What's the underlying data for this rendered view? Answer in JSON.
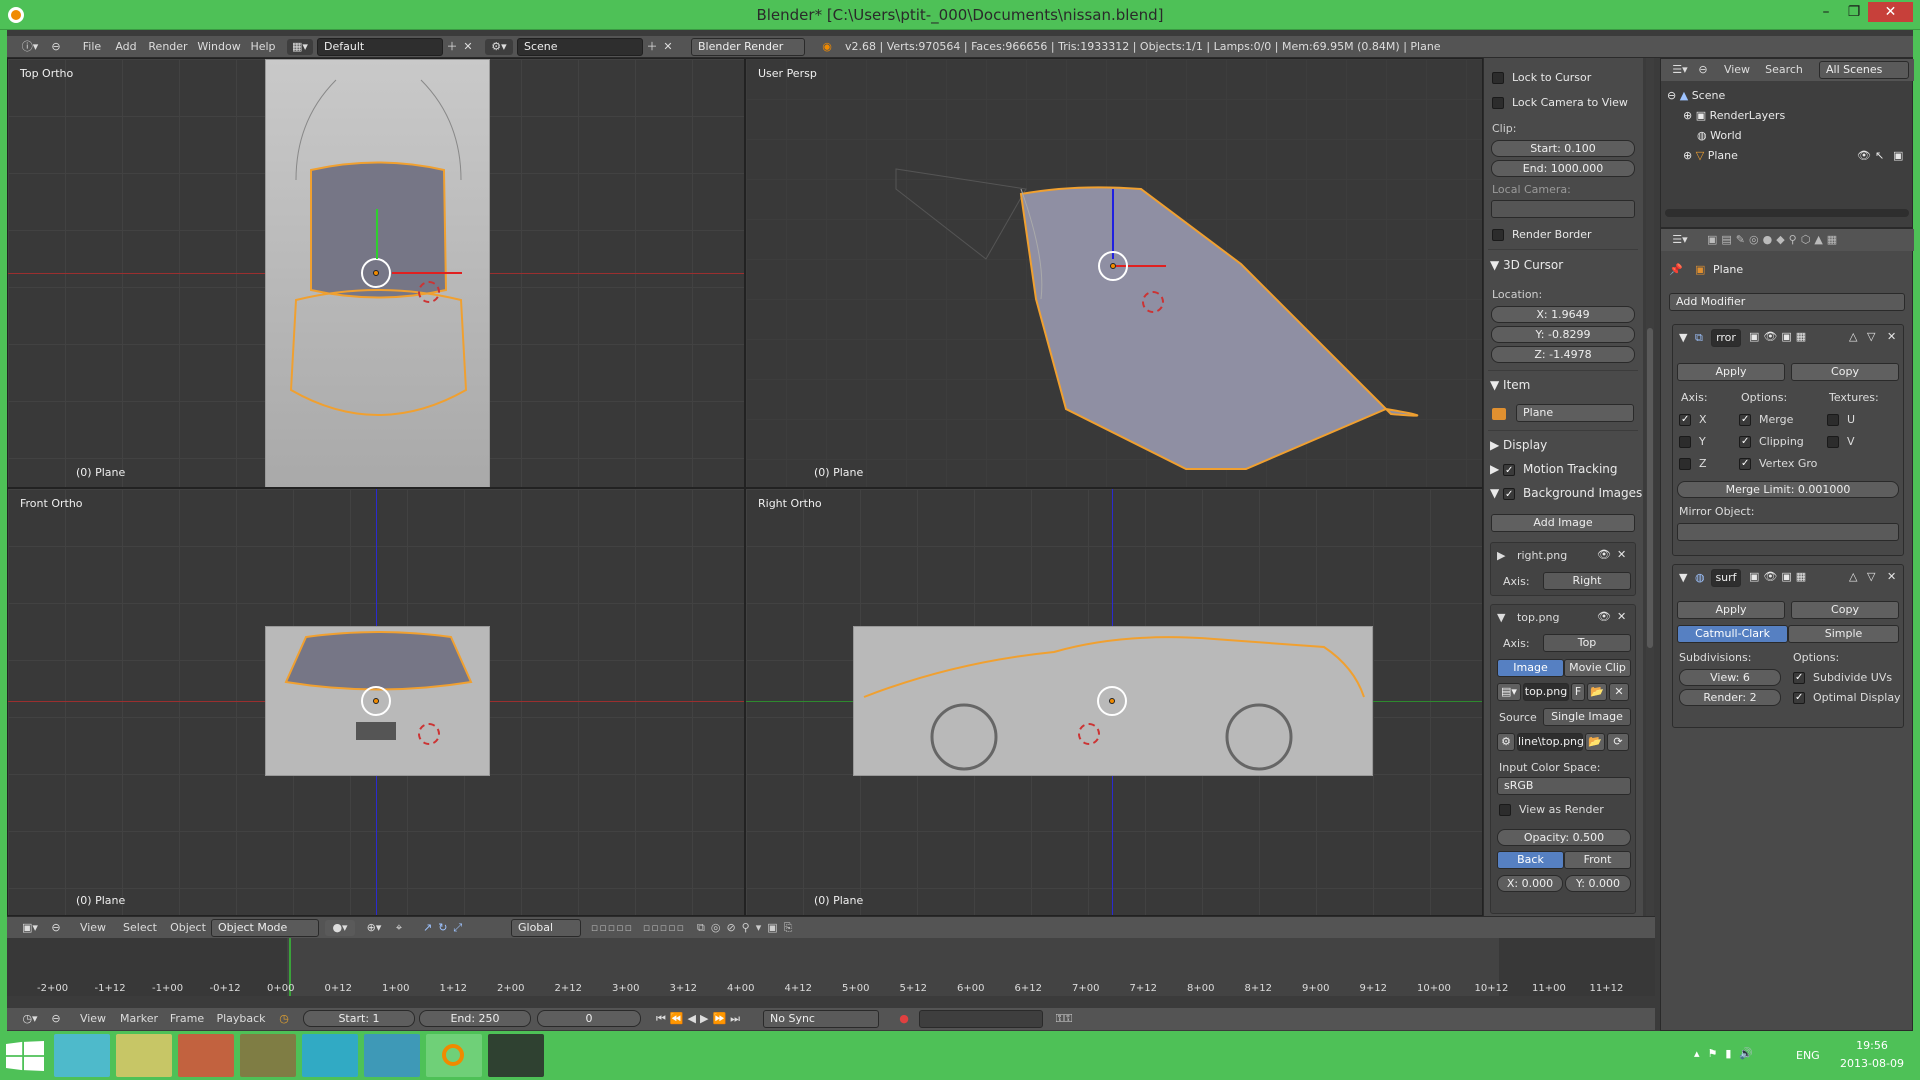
{
  "title": "Blender* [C:\\Users\\ptit-_000\\Documents\\nissan.blend]",
  "window_controls": {
    "minimize": "–",
    "maximize": "❐",
    "close": "✕"
  },
  "infobar": {
    "menus": [
      "File",
      "Add",
      "Render",
      "Window",
      "Help"
    ],
    "layout": "Default",
    "scene": "Scene",
    "engine": "Blender Render",
    "stats": "v2.68 | Verts:970564 | Faces:966656 | Tris:1933312 | Objects:1/1 | Lamps:0/0 | Mem:69.95M (0.84M) | Plane"
  },
  "viewports": {
    "top": {
      "label": "Top Ortho",
      "object": "(0) Plane"
    },
    "persp": {
      "label": "User Persp",
      "object": "(0) Plane"
    },
    "front": {
      "label": "Front Ortho",
      "object": "(0) Plane"
    },
    "right": {
      "label": "Right Ortho",
      "object": "(0) Plane"
    }
  },
  "npanel": {
    "lock_to_cursor": "Lock to Cursor",
    "lock_camera": "Lock Camera to View",
    "clip": "Clip:",
    "clip_start": "Start: 0.100",
    "clip_end": "End: 1000.000",
    "local_camera": "Local Camera:",
    "render_border": "Render Border",
    "cursor_header": "3D Cursor",
    "location": "Location:",
    "loc_x": "X: 1.9649",
    "loc_y": "Y: -0.8299",
    "loc_z": "Z: -1.4978",
    "item_header": "Item",
    "item_name": "Plane",
    "display": "Display",
    "motion_tracking": "Motion Tracking",
    "bg_images": "Background Images",
    "add_image": "Add Image",
    "bg1_name": "right.png",
    "axis_label": "Axis:",
    "bg1_axis": "Right",
    "bg2_name": "top.png",
    "bg2_axis": "Top",
    "tab_image": "Image",
    "tab_movie": "Movie Clip",
    "img_field": "top.png",
    "img_flag": "F",
    "source_label": "Source",
    "source_value": "Single Image",
    "filepath": "line\\top.png",
    "input_cs": "Input Color Space:",
    "cs_value": "sRGB",
    "view_as_render": "View as Render",
    "opacity": "Opacity: 0.500",
    "back": "Back",
    "front": "Front",
    "off_x": "X: 0.000",
    "off_y": "Y: 0.000"
  },
  "outliner": {
    "menu_view": "View",
    "menu_search": "Search",
    "filter": "All Scenes",
    "rows": [
      "Scene",
      "RenderLayers",
      "World",
      "Plane"
    ]
  },
  "properties": {
    "object_name": "Plane",
    "add_modifier": "Add Modifier",
    "mirror": {
      "name": "rror",
      "apply": "Apply",
      "copy": "Copy",
      "axis": "Axis:",
      "options": "Options:",
      "textures": "Textures:",
      "x": "X",
      "y": "Y",
      "z": "Z",
      "merge": "Merge",
      "clipping": "Clipping",
      "vertex_gro": "Vertex Gro",
      "u": "U",
      "v": "V",
      "merge_limit": "Merge Limit: 0.001000",
      "mirror_object": "Mirror Object:"
    },
    "subsurf": {
      "name": "surf",
      "apply": "Apply",
      "copy": "Copy",
      "catmull": "Catmull-Clark",
      "simple": "Simple",
      "subdivisions": "Subdivisions:",
      "options": "Options:",
      "view": "View: 6",
      "render": "Render: 2",
      "subdivide_uvs": "Subdivide UVs",
      "optimal_display": "Optimal Display"
    }
  },
  "viewport_header": {
    "menus": [
      "View",
      "Select",
      "Object"
    ],
    "mode": "Object Mode",
    "orientation": "Global"
  },
  "timeline": {
    "ticks": [
      "-2+00",
      "-1+12",
      "-1+00",
      "-0+12",
      "0+00",
      "0+12",
      "1+00",
      "1+12",
      "2+00",
      "2+12",
      "3+00",
      "3+12",
      "4+00",
      "4+12",
      "5+00",
      "5+12",
      "6+00",
      "6+12",
      "7+00",
      "7+12",
      "8+00",
      "8+12",
      "9+00",
      "9+12",
      "10+00",
      "10+12",
      "11+00",
      "11+12"
    ],
    "menus": [
      "View",
      "Marker",
      "Frame",
      "Playback"
    ],
    "start": "Start: 1",
    "end": "End: 250",
    "current": "0",
    "sync": "No Sync"
  },
  "taskbar": {
    "lang": "ENG",
    "time": "19:56",
    "date": "2013-08-09"
  },
  "colors": {
    "accent": "#4ec157",
    "selected": "#5680c2",
    "orange": "#f08a00"
  }
}
